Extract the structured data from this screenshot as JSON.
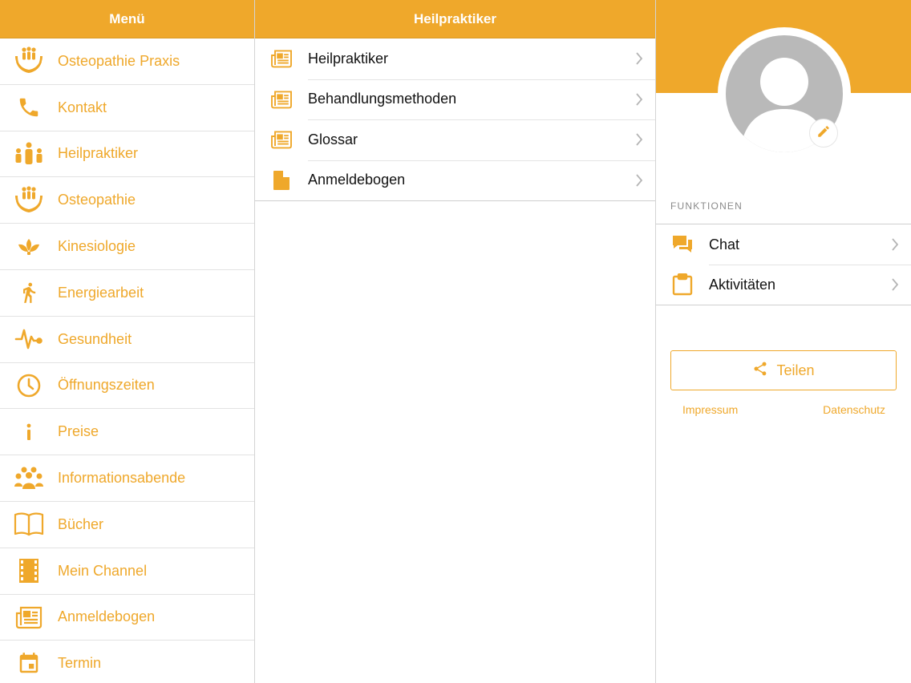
{
  "left": {
    "title": "Menü",
    "items": [
      {
        "label": "Osteopathie Praxis",
        "icon": "hands-people-icon"
      },
      {
        "label": "Kontakt",
        "icon": "phone-icon"
      },
      {
        "label": "Heilpraktiker",
        "icon": "family-icon"
      },
      {
        "label": "Osteopathie",
        "icon": "hands-people-icon"
      },
      {
        "label": "Kinesiologie",
        "icon": "lotus-icon"
      },
      {
        "label": "Energiearbeit",
        "icon": "walking-icon"
      },
      {
        "label": "Gesundheit",
        "icon": "heartbeat-icon"
      },
      {
        "label": "Öffnungszeiten",
        "icon": "clock-icon"
      },
      {
        "label": "Preise",
        "icon": "info-icon"
      },
      {
        "label": "Informationsabende",
        "icon": "group-icon"
      },
      {
        "label": "Bücher",
        "icon": "book-icon"
      },
      {
        "label": "Mein Channel",
        "icon": "film-icon"
      },
      {
        "label": "Anmeldebogen",
        "icon": "newspaper-icon"
      },
      {
        "label": "Termin",
        "icon": "calendar-icon"
      }
    ]
  },
  "middle": {
    "title": "Heilpraktiker",
    "items": [
      {
        "label": "Heilpraktiker",
        "icon": "newspaper-icon"
      },
      {
        "label": "Behandlungsmethoden",
        "icon": "newspaper-icon"
      },
      {
        "label": "Glossar",
        "icon": "newspaper-icon"
      },
      {
        "label": "Anmeldebogen",
        "icon": "document-icon"
      }
    ]
  },
  "right": {
    "section_title": "FUNKTIONEN",
    "functions": [
      {
        "label": "Chat",
        "icon": "chat-icon"
      },
      {
        "label": "Aktivitäten",
        "icon": "clipboard-icon"
      }
    ],
    "share_label": "Teilen",
    "impressum": "Impressum",
    "datenschutz": "Datenschutz"
  },
  "colors": {
    "accent": "#efa82b",
    "avatar_gray": "#b9b9b9"
  }
}
